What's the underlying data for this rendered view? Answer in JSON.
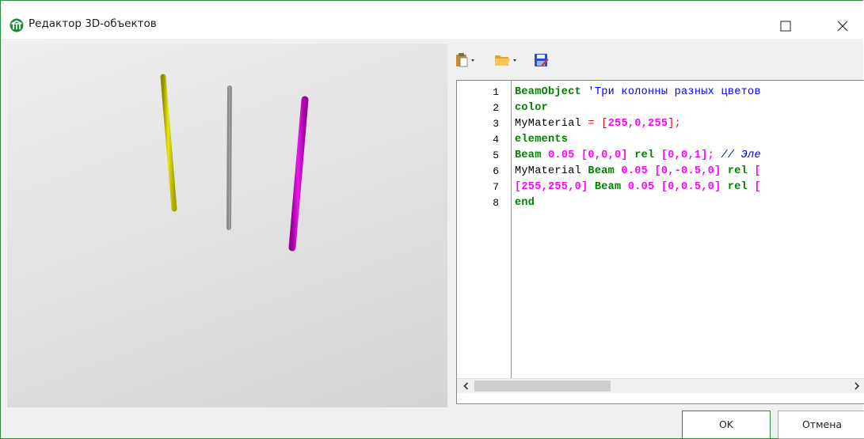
{
  "window": {
    "title": "Редактор 3D-объектов",
    "border_color": "#2e8b3f",
    "icons": [
      "app-icon",
      "maximize-icon",
      "close-icon"
    ]
  },
  "viewport": {
    "objects": [
      {
        "name": "yellow-column",
        "color": "#cccc00"
      },
      {
        "name": "gray-column",
        "color": "#9e9e9e"
      },
      {
        "name": "magenta-column",
        "color": "#cc00cc"
      }
    ]
  },
  "toolbar": {
    "icons": [
      "paste-dropdown-icon",
      "open-folder-dropdown-icon",
      "save-icon"
    ]
  },
  "editor": {
    "line_numbers": [
      "1",
      "2",
      "3",
      "4",
      "5",
      "6",
      "7",
      "8"
    ],
    "lines": [
      [
        {
          "t": "BeamObject",
          "c": "kw"
        },
        {
          "t": " 'Три колонны разных цветов",
          "c": "str"
        }
      ],
      [
        {
          "t": "color",
          "c": "kw"
        }
      ],
      [
        {
          "t": "MyMaterial",
          "c": "id"
        },
        {
          "t": " = ",
          "c": "op"
        },
        {
          "t": "[",
          "c": "op"
        },
        {
          "t": "255,0,255",
          "c": "num"
        },
        {
          "t": "];",
          "c": "op"
        }
      ],
      [
        {
          "t": "elements",
          "c": "kw"
        }
      ],
      [
        {
          "t": "Beam",
          "c": "kw"
        },
        {
          "t": " 0.05 [0,0,0] ",
          "c": "num"
        },
        {
          "t": "rel",
          "c": "kw"
        },
        {
          "t": " [0,0,1]; ",
          "c": "num"
        },
        {
          "t": "// Эле",
          "c": "cmt"
        }
      ],
      [
        {
          "t": "MyMaterial ",
          "c": "id"
        },
        {
          "t": "Beam",
          "c": "kw"
        },
        {
          "t": " 0.05 [0,-0.5,0] ",
          "c": "num"
        },
        {
          "t": "rel",
          "c": "kw"
        },
        {
          "t": " [",
          "c": "num"
        }
      ],
      [
        {
          "t": "[255,255,0] ",
          "c": "num"
        },
        {
          "t": "Beam",
          "c": "kw"
        },
        {
          "t": " 0.05 [0,0.5,0] ",
          "c": "num"
        },
        {
          "t": "rel",
          "c": "kw"
        },
        {
          "t": " [",
          "c": "num"
        }
      ],
      [
        {
          "t": "end",
          "c": "kw"
        }
      ]
    ]
  },
  "scrollbar": {
    "left_arrow": "‹",
    "right_arrow": "›"
  },
  "footer": {
    "ok_label": "OK",
    "cancel_label": "Отмена"
  },
  "colors": {
    "keyword": "#008000",
    "number": "#ff00ff",
    "operator": "#ff0000",
    "string": "#0000ff",
    "comment": "#0000c0"
  }
}
